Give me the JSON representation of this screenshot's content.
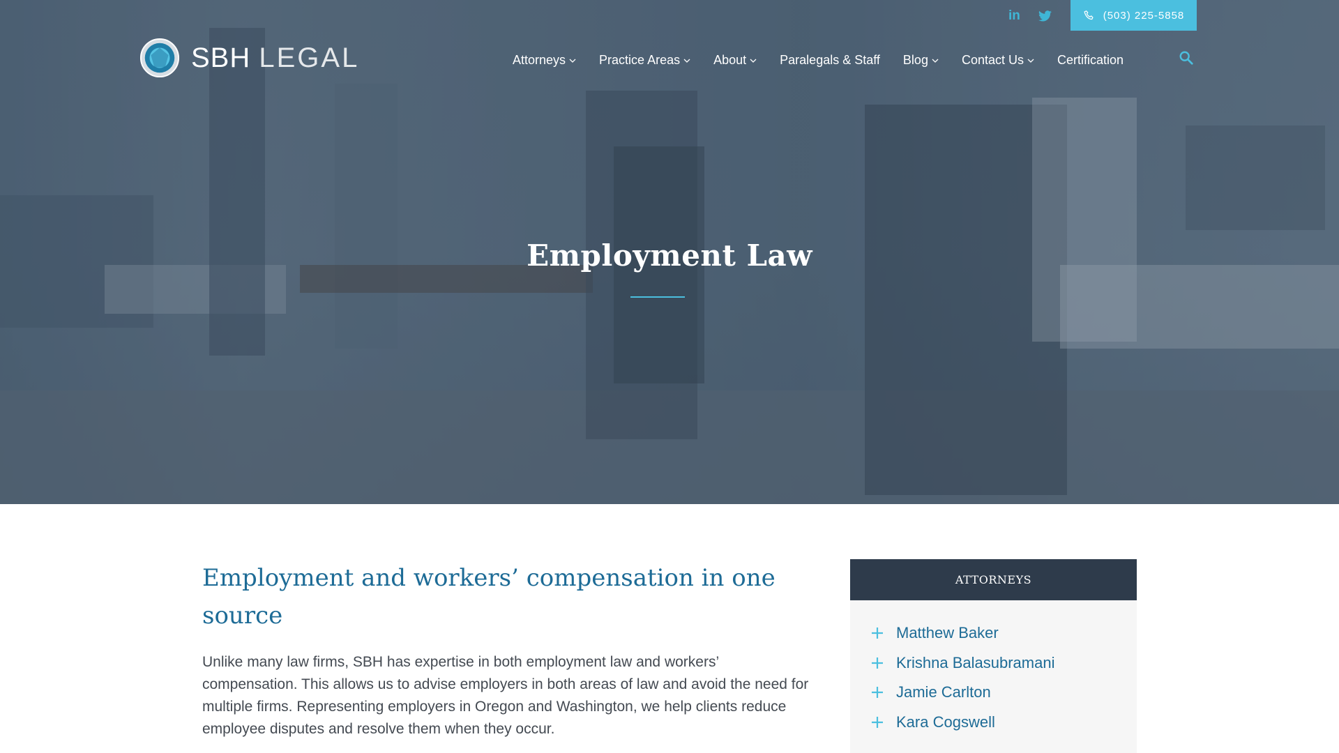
{
  "header": {
    "brand": {
      "primary": "SBH",
      "secondary": "LEGAL"
    },
    "social": [
      {
        "label": "in",
        "icon": "linkedin-icon"
      },
      {
        "label": "",
        "icon": "twitter-icon"
      }
    ],
    "phone": {
      "label": "(503) 225-5858",
      "icon": "phone-icon"
    },
    "nav": [
      {
        "label": "Attorneys",
        "has_dropdown": true
      },
      {
        "label": "Practice Areas",
        "has_dropdown": true
      },
      {
        "label": "About",
        "has_dropdown": true
      },
      {
        "label": "Paralegals & Staff",
        "has_dropdown": false
      },
      {
        "label": "Blog",
        "has_dropdown": true
      },
      {
        "label": "Contact Us",
        "has_dropdown": true
      },
      {
        "label": "Certification",
        "has_dropdown": false
      }
    ]
  },
  "hero": {
    "title": "Employment Law"
  },
  "main": {
    "heading": "Employment and workers’ compensation in one source",
    "body": "Unlike many law firms, SBH has expertise in both employment law and workers’ compensation. This allows us to advise employers in both areas of law and avoid the need for multiple firms.  Representing employers in Oregon and Washington, we help clients reduce employee disputes and resolve them when they occur."
  },
  "sidebar": {
    "title": "ATTORNEYS",
    "attorneys": [
      "Matthew Baker",
      "Krishna Balasubramani",
      "Jamie Carlton",
      "Kara Cogswell"
    ]
  },
  "colors": {
    "accent": "#4bbfdf",
    "heading_blue": "#1d6b96",
    "sidebar_header": "#2e3b4b",
    "hero_overlay": "#3a4e62"
  }
}
